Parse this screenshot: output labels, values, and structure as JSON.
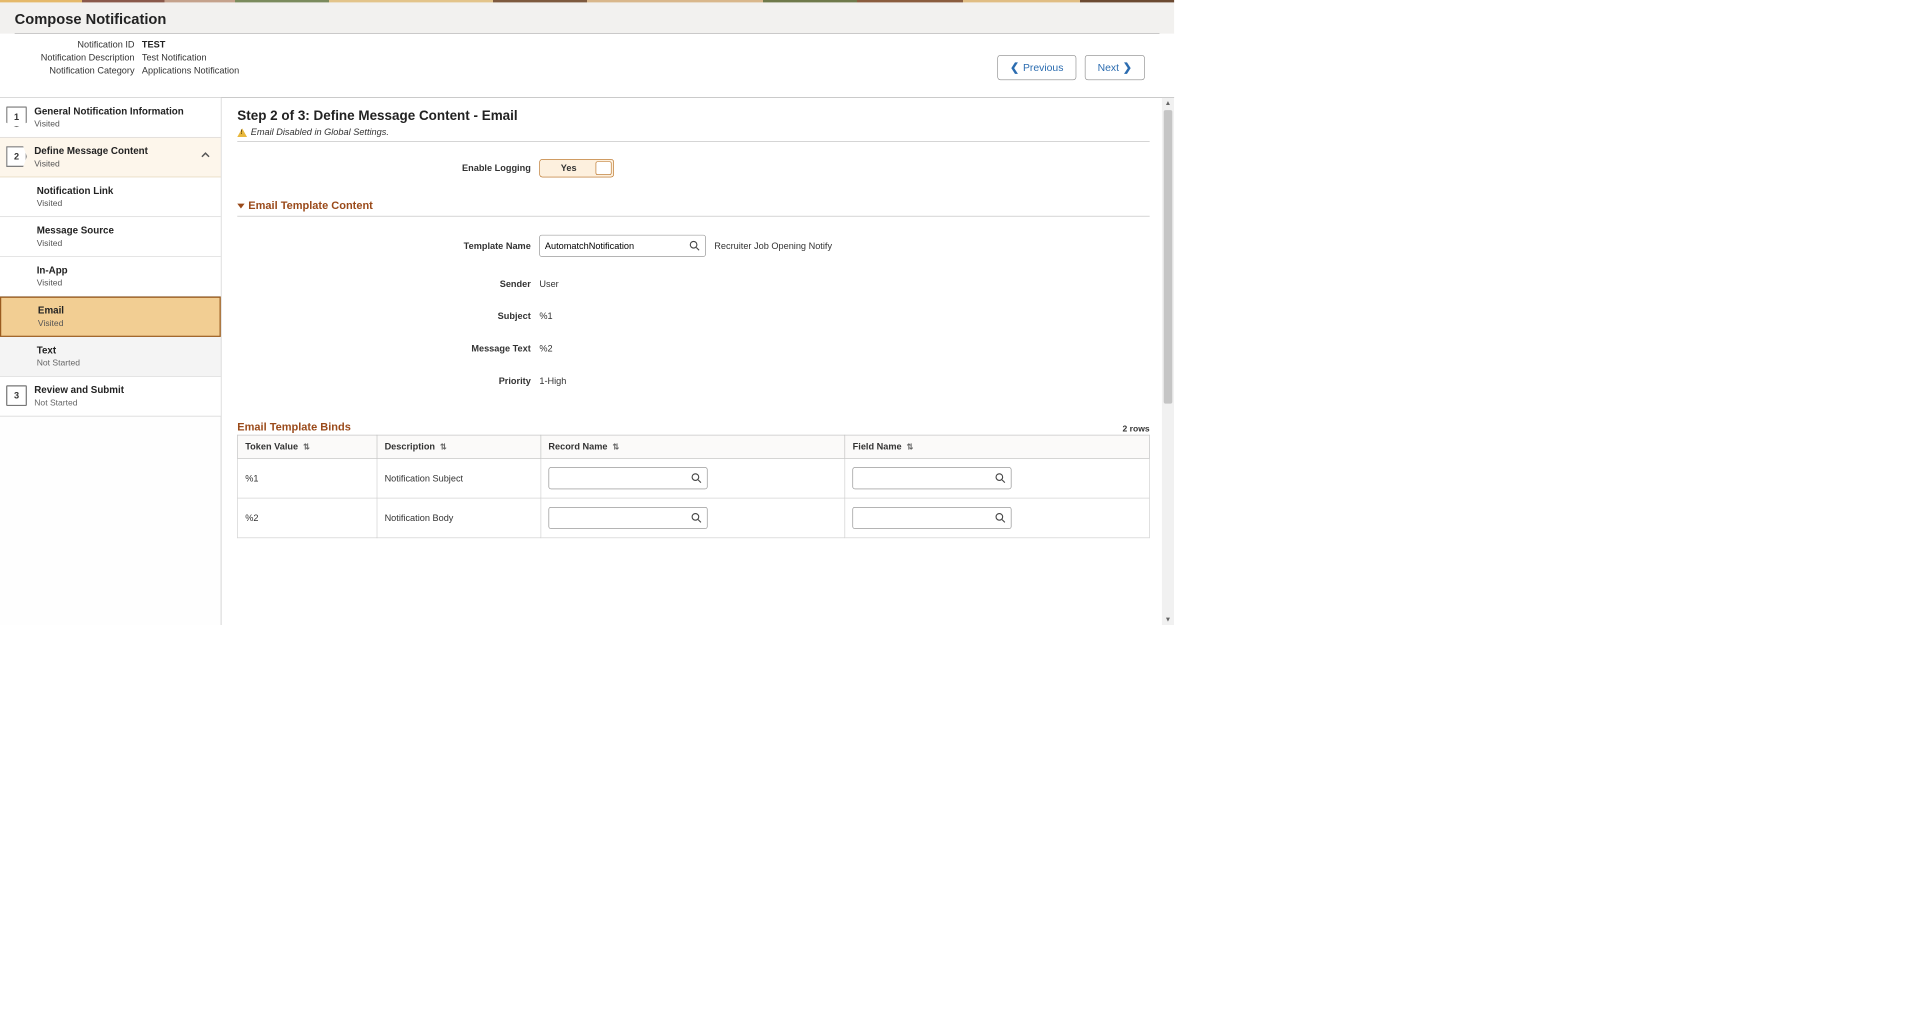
{
  "header": {
    "title": "Compose Notification",
    "fields": {
      "notification_id_label": "Notification ID",
      "notification_id_value": "TEST",
      "notification_desc_label": "Notification Description",
      "notification_desc_value": "Test Notification",
      "notification_category_label": "Notification Category",
      "notification_category_value": "Applications Notification"
    },
    "previous": "Previous",
    "next": "Next"
  },
  "sidebar": {
    "step1": {
      "num": "1",
      "title": "General Notification Information",
      "status": "Visited"
    },
    "step2": {
      "num": "2",
      "title": "Define Message Content",
      "status": "Visited"
    },
    "sub_notification_link": {
      "title": "Notification Link",
      "status": "Visited"
    },
    "sub_message_source": {
      "title": "Message Source",
      "status": "Visited"
    },
    "sub_in_app": {
      "title": "In-App",
      "status": "Visited"
    },
    "sub_email": {
      "title": "Email",
      "status": "Visited"
    },
    "sub_text": {
      "title": "Text",
      "status": "Not Started"
    },
    "step3": {
      "num": "3",
      "title": "Review and Submit",
      "status": "Not Started"
    }
  },
  "content": {
    "step_heading": "Step 2 of 3: Define Message Content - Email",
    "warning": "Email Disabled in Global Settings.",
    "enable_logging_label": "Enable Logging",
    "enable_logging_value": "Yes",
    "section_email_template": "Email Template Content",
    "template_name_label": "Template Name",
    "template_name_value": "AutomatchNotification",
    "template_desc": "Recruiter Job Opening Notify",
    "sender_label": "Sender",
    "sender_value": "User",
    "subject_label": "Subject",
    "subject_value": "%1",
    "message_text_label": "Message Text",
    "message_text_value": "%2",
    "priority_label": "Priority",
    "priority_value": "1-High",
    "binds_heading": "Email Template Binds",
    "binds_rows_label": "2 rows",
    "binds_cols": {
      "token": "Token Value",
      "description": "Description",
      "record": "Record Name",
      "field": "Field Name"
    },
    "binds": [
      {
        "token": "%1",
        "description": "Notification Subject",
        "record": "",
        "field": ""
      },
      {
        "token": "%2",
        "description": "Notification Body",
        "record": "",
        "field": ""
      }
    ]
  }
}
